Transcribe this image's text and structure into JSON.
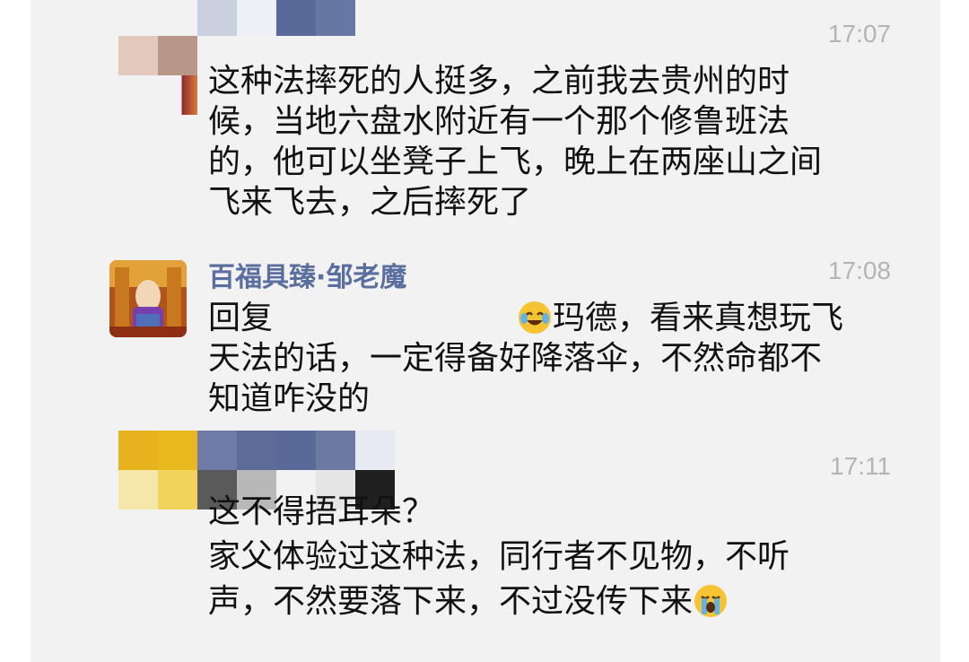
{
  "messages": [
    {
      "time": "17:07",
      "lines": [
        "这种法摔死的人挺多，之前我去贵州的时",
        "候，当地六盘水附近有一个那个修鲁班法",
        "的，他可以坐凳子上飞，晚上在两座山之间",
        "飞来飞去，之后摔死了"
      ]
    },
    {
      "sender": "百福具臻·邹老魔",
      "time": "17:08",
      "reply_prefix": "回复",
      "reply_name_tail": "玛德，看来真想玩飞",
      "reply_emoji": "crying-laughing-face-icon",
      "lines": [
        "天法的话，一定得备好降落伞，不然命都不",
        "知道咋没的"
      ]
    },
    {
      "time": "17:11",
      "lines": [
        "这不得捂耳朵？",
        "家父体验过这种法，同行者不见物，不听",
        "声，不然要落下来，不过没传下来"
      ],
      "end_emoji": "loudly-crying-face-icon"
    }
  ],
  "colors": {
    "background": "#f2f2f2",
    "sender_name": "#5a6fa0",
    "timestamp": "#b4b4b4",
    "text": "#111111"
  }
}
